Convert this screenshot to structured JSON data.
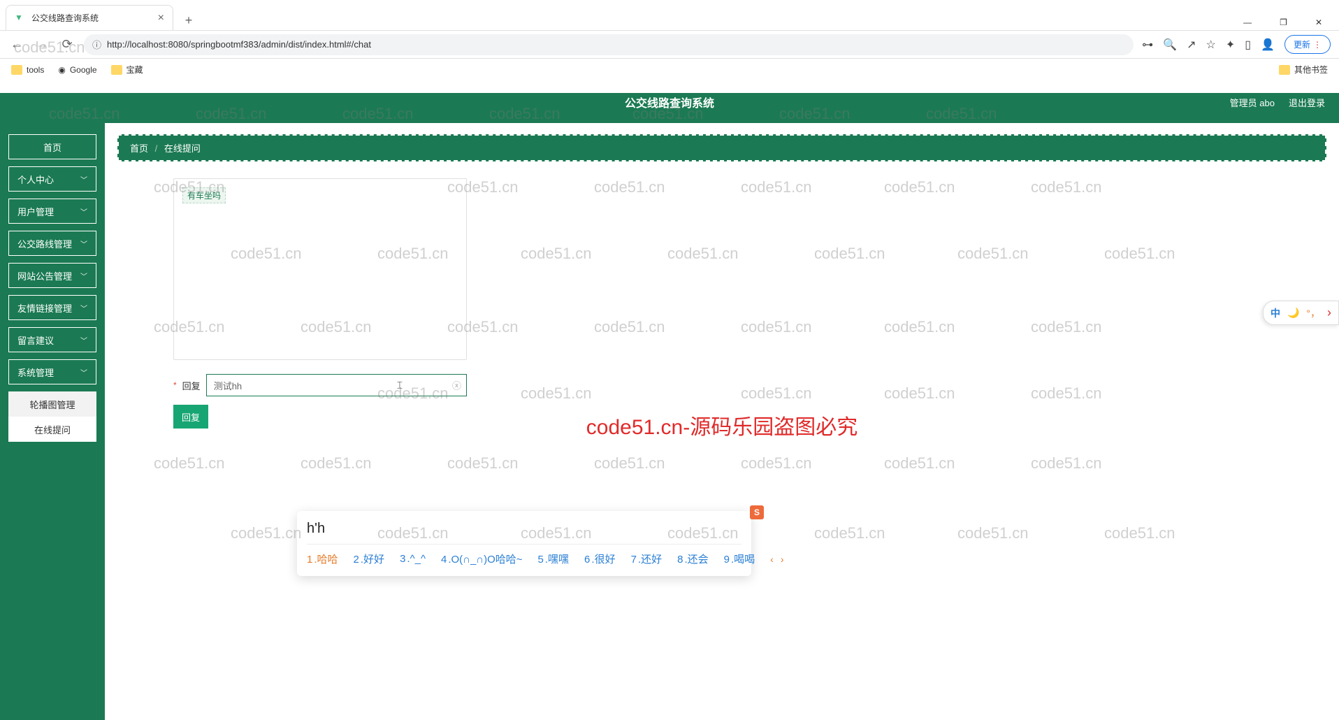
{
  "browser": {
    "tab_title": "公交线路查询系统",
    "url": "http://localhost:8080/springbootmf383/admin/dist/index.html#/chat",
    "update_label": "更新",
    "bookmarks": {
      "tools": "tools",
      "google": "Google",
      "baozang": "宝藏",
      "other": "其他书签"
    }
  },
  "header": {
    "title": "公交线路查询系统",
    "user": "管理员 abo",
    "logout": "退出登录"
  },
  "sidebar": {
    "items": [
      {
        "label": "首页",
        "expandable": false
      },
      {
        "label": "个人中心",
        "expandable": true
      },
      {
        "label": "用户管理",
        "expandable": true
      },
      {
        "label": "公交路线管理",
        "expandable": true
      },
      {
        "label": "网站公告管理",
        "expandable": true
      },
      {
        "label": "友情链接管理",
        "expandable": true
      },
      {
        "label": "留言建议",
        "expandable": true
      },
      {
        "label": "系统管理",
        "expandable": true
      }
    ],
    "submenu": [
      {
        "label": "轮播图管理",
        "active": false
      },
      {
        "label": "在线提问",
        "active": true
      }
    ]
  },
  "breadcrumb": {
    "home": "首页",
    "current": "在线提问"
  },
  "chat": {
    "msg": "有车坐吗",
    "reply_label": "回复",
    "reply_value": "测试hh",
    "reply_btn": "回复"
  },
  "ime": {
    "buffer": "h'h",
    "candidates": [
      {
        "n": "1",
        "t": "哈哈"
      },
      {
        "n": "2",
        "t": "好好"
      },
      {
        "n": "3",
        "t": "^_^"
      },
      {
        "n": "4",
        "t": "O(∩_∩)O哈哈~"
      },
      {
        "n": "5",
        "t": "嘿嘿"
      },
      {
        "n": "6",
        "t": "很好"
      },
      {
        "n": "7",
        "t": "还好"
      },
      {
        "n": "8",
        "t": "还会"
      },
      {
        "n": "9",
        "t": "喝喝"
      }
    ],
    "logo": "S"
  },
  "side_widget": {
    "zh": "中",
    "comma": "°，"
  },
  "watermark_text": "code51.cn",
  "wm_red": "code51.cn-源码乐园盗图必究"
}
